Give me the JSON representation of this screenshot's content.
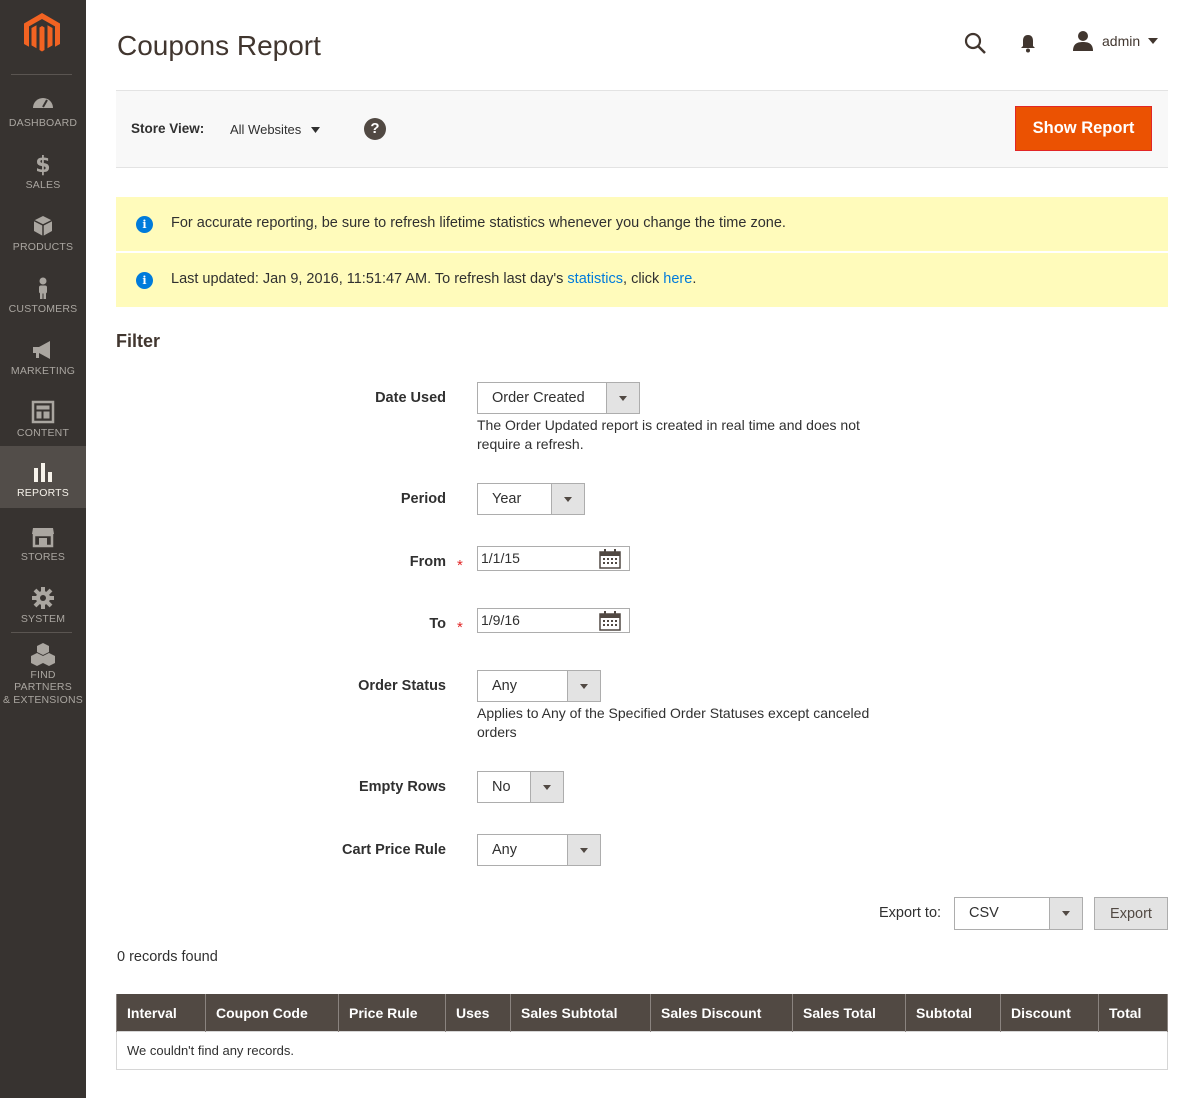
{
  "header": {
    "title": "Coupons Report",
    "user": "admin"
  },
  "sidebar": {
    "items": [
      {
        "label": "Dashboard",
        "icon": "dashboard-icon"
      },
      {
        "label": "Sales",
        "icon": "dollar-icon"
      },
      {
        "label": "Products",
        "icon": "box-icon"
      },
      {
        "label": "Customers",
        "icon": "person-icon"
      },
      {
        "label": "Marketing",
        "icon": "megaphone-icon"
      },
      {
        "label": "Content",
        "icon": "layout-icon"
      },
      {
        "label": "Reports",
        "icon": "bar-chart-icon"
      },
      {
        "label": "Stores",
        "icon": "storefront-icon"
      },
      {
        "label": "System",
        "icon": "gear-icon"
      },
      {
        "label_line1": "Find Partners",
        "label_line2": "& Extensions",
        "icon": "cubes-icon"
      }
    ]
  },
  "store_bar": {
    "label": "Store View:",
    "value": "All Websites",
    "help": "?",
    "show_report": "Show Report"
  },
  "messages": {
    "m1": "For accurate reporting, be sure to refresh lifetime statistics whenever you change the time zone.",
    "m2_pre": "Last updated: Jan 9, 2016, 11:51:47 AM. To refresh last day's ",
    "m2_link1": "statistics",
    "m2_mid": ", click ",
    "m2_link2": "here",
    "m2_end": "."
  },
  "filter": {
    "title": "Filter",
    "date_used": {
      "label": "Date Used",
      "value": "Order Created",
      "note": "The Order Updated report is created in real time and does not require a refresh."
    },
    "period": {
      "label": "Period",
      "value": "Year"
    },
    "from": {
      "label": "From",
      "value": "1/1/15",
      "required": "*"
    },
    "to": {
      "label": "To",
      "value": "1/9/16",
      "required": "*"
    },
    "order_status": {
      "label": "Order Status",
      "value": "Any",
      "note": "Applies to Any of the Specified Order Statuses except canceled orders"
    },
    "empty_rows": {
      "label": "Empty Rows",
      "value": "No"
    },
    "cart_price_rule": {
      "label": "Cart Price Rule",
      "value": "Any"
    }
  },
  "export": {
    "label": "Export to:",
    "format": "CSV",
    "button": "Export"
  },
  "grid": {
    "records": "0 records found",
    "columns": [
      "Interval",
      "Coupon Code",
      "Price Rule",
      "Uses",
      "Sales Subtotal",
      "Sales Discount",
      "Sales Total",
      "Subtotal",
      "Discount",
      "Total"
    ],
    "empty": "We couldn't find any records."
  },
  "colors": {
    "accent": "#eb5202",
    "sidebar": "#373330",
    "header_row": "#514943",
    "notice": "#fffbbb",
    "link": "#007bdb"
  }
}
